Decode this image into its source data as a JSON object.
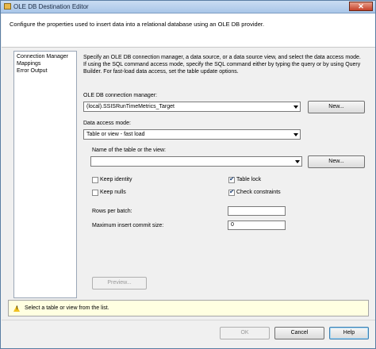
{
  "window": {
    "title": "OLE DB Destination Editor",
    "close_label": "✕"
  },
  "header": {
    "text": "Configure the properties used to insert data into a relational database using an OLE DB provider."
  },
  "nav": {
    "items": [
      "Connection Manager",
      "Mappings",
      "Error Output"
    ]
  },
  "main": {
    "description": "Specify an OLE DB connection manager, a data source, or a data source view, and select the data access mode. If using the SQL command access mode, specify the SQL command either by typing the query or by using Query Builder. For fast-load data access, set the table update options.",
    "conn_label": "OLE DB connection manager:",
    "conn_value": "(local).SSISRunTimeMetrics_Target",
    "new_conn_button": "New...",
    "access_label": "Data access mode:",
    "access_value": "Table or view - fast load",
    "table_label": "Name of the table or the view:",
    "table_value": "",
    "new_table_button": "New...",
    "options": {
      "keep_identity": {
        "label": "Keep identity",
        "checked": false
      },
      "keep_nulls": {
        "label": "Keep nulls",
        "checked": false
      },
      "table_lock": {
        "label": "Table lock",
        "checked": true
      },
      "check_constraints": {
        "label": "Check constraints",
        "checked": true
      }
    },
    "rows_label": "Rows per batch:",
    "rows_value": "",
    "commit_label": "Maximum insert commit size:",
    "commit_value": "0",
    "preview_button": "Preview..."
  },
  "message": {
    "text": "Select a table or view from the list.",
    "icon": "warning-icon"
  },
  "footer": {
    "ok": "OK",
    "cancel": "Cancel",
    "help": "Help"
  },
  "colors": {
    "titlebar": "#a9c6e8",
    "window_bg": "#f0f0f0",
    "message_bg": "#ffffe1",
    "close": "#c4412a"
  }
}
